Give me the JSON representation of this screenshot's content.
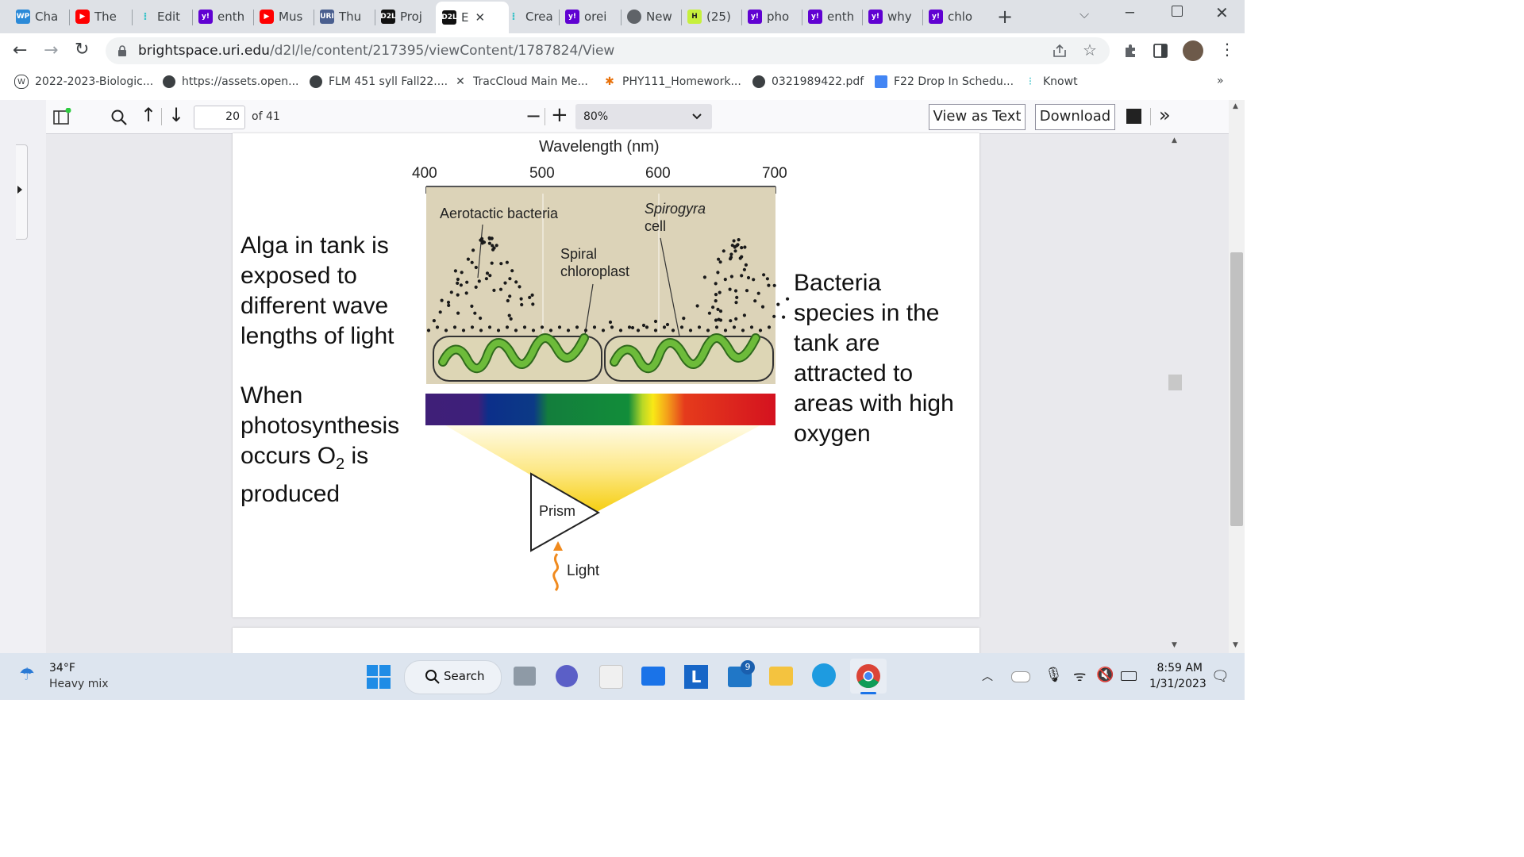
{
  "tabs": [
    {
      "favicon": "WP",
      "label": "Cha",
      "color": "#2b8ad8"
    },
    {
      "favicon": "youtube-icon",
      "label": "The",
      "color": "#ff0000"
    },
    {
      "favicon": "dots-icon",
      "label": "Edit",
      "color": "#3cc3c9"
    },
    {
      "favicon": "y!",
      "label": "enth",
      "color": "#6001d2"
    },
    {
      "favicon": "youtube-icon",
      "label": "Mus",
      "color": "#ff0000"
    },
    {
      "favicon": "URI",
      "label": "Thu",
      "color": "#4a5f8f"
    },
    {
      "favicon": "D2L",
      "label": "Proj",
      "color": "#111111"
    },
    {
      "favicon": "D2L",
      "label": "E",
      "color": "#111111",
      "active": true
    },
    {
      "favicon": "dots-icon",
      "label": "Crea",
      "color": "#3cc3c9"
    },
    {
      "favicon": "y!",
      "label": "orei",
      "color": "#6001d2"
    },
    {
      "favicon": "globe-icon",
      "label": "New",
      "color": "#5f6368"
    },
    {
      "favicon": "H",
      "label": "(25)",
      "color": "#c6f03c"
    },
    {
      "favicon": "y!",
      "label": "pho",
      "color": "#6001d2"
    },
    {
      "favicon": "y!",
      "label": "enth",
      "color": "#6001d2"
    },
    {
      "favicon": "y!",
      "label": "why",
      "color": "#6001d2"
    },
    {
      "favicon": "y!",
      "label": "chlo",
      "color": "#6001d2"
    }
  ],
  "url": {
    "host": "brightspace.uri.edu",
    "path": "/d2l/le/content/217395/viewContent/1787824/View"
  },
  "bookmarks": [
    {
      "icon": "wordpress-icon",
      "label": "2022-2023-Biologic..."
    },
    {
      "icon": "globe-icon",
      "label": "https://assets.open..."
    },
    {
      "icon": "globe-icon",
      "label": "FLM 451 syll Fall22...."
    },
    {
      "icon": "traccloud-icon",
      "label": "TracCloud Main Me..."
    },
    {
      "icon": "homework-icon",
      "label": "PHY111_Homework..."
    },
    {
      "icon": "globe-icon",
      "label": "0321989422.pdf"
    },
    {
      "icon": "doc-icon",
      "label": "F22 Drop In Schedu..."
    },
    {
      "icon": "dots-icon",
      "label": "Knowt"
    }
  ],
  "pdf_toolbar": {
    "page_current": "20",
    "page_total": "of 41",
    "zoom": "80%",
    "view_as_text": "View as Text",
    "download": "Download"
  },
  "figure": {
    "axis_title": "Wavelength (nm)",
    "ticks": [
      "400",
      "500",
      "600",
      "700"
    ],
    "label_bacteria": "Aerotactic bacteria",
    "label_spirogyra_1": "Spirogyra",
    "label_spirogyra_2": "cell",
    "label_chloroplast_1": "Spiral",
    "label_chloroplast_2": "chloroplast",
    "label_prism": "Prism",
    "label_light": "Light"
  },
  "notes": {
    "left_1": [
      "Alga in tank is",
      "exposed to",
      "different wave",
      "lengths of light"
    ],
    "left_2_a": "When",
    "left_2_b": "photosynthesis",
    "left_2_c_pre": "occurs O",
    "left_2_c_sub": "2",
    "left_2_c_post": " is",
    "left_2_d": "produced",
    "right": [
      "Bacteria",
      "species in the",
      "tank are",
      "attracted to",
      "areas with high",
      "oxygen"
    ]
  },
  "taskbar": {
    "weather_temp": "34°F",
    "weather_desc": "Heavy mix",
    "search": "Search",
    "time": "8:59 AM",
    "date": "1/31/2023",
    "badge": "9"
  }
}
